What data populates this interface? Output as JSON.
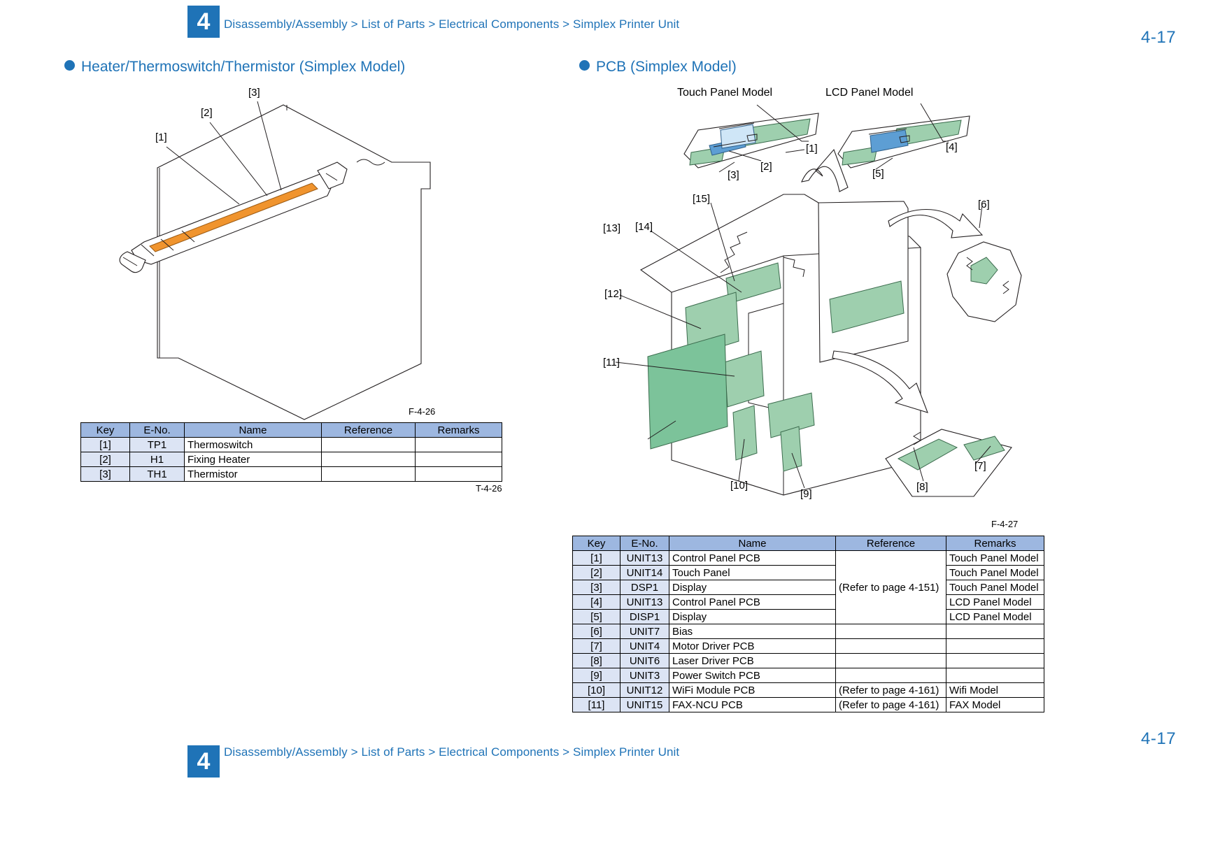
{
  "header": {
    "chapter": "4",
    "breadcrumb": "Disassembly/Assembly > List of Parts > Electrical Components > Simplex Printer Unit",
    "page_number": "4-17"
  },
  "footer": {
    "chapter": "4",
    "breadcrumb": "Disassembly/Assembly > List of Parts > Electrical Components > Simplex Printer Unit",
    "page_number": "4-17"
  },
  "colors": {
    "accent_blue": "#1f73b7",
    "table_header": "#9db7e0",
    "table_key_cell": "#dce4f4",
    "pcb_green": "#9ecfae",
    "display_blue": "#cfe6f7",
    "heater_orange": "#f0942e"
  },
  "sections": {
    "left": {
      "title": "Heater/Thermoswitch/Thermistor (Simplex Model)",
      "figure_caption": "F-4-26",
      "table_caption": "T-4-26",
      "callouts": [
        "[1]",
        "[2]",
        "[3]"
      ],
      "table": {
        "headers": [
          "Key",
          "E-No.",
          "Name",
          "Reference",
          "Remarks"
        ],
        "rows": [
          {
            "key": "[1]",
            "eno": "TP1",
            "name": "Thermoswitch",
            "reference": "",
            "remarks": ""
          },
          {
            "key": "[2]",
            "eno": "H1",
            "name": "Fixing Heater",
            "reference": "",
            "remarks": ""
          },
          {
            "key": "[3]",
            "eno": "TH1",
            "name": "Thermistor",
            "reference": "",
            "remarks": ""
          }
        ]
      }
    },
    "right": {
      "title": "PCB (Simplex Model)",
      "figure_caption": "F-4-27",
      "model_labels": [
        "Touch Panel Model",
        "LCD Panel Model"
      ],
      "callouts": [
        "[1]",
        "[2]",
        "[3]",
        "[4]",
        "[5]",
        "[6]",
        "[7]",
        "[8]",
        "[9]",
        "[10]",
        "[11]",
        "[12]",
        "[13]",
        "[14]",
        "[15]"
      ],
      "table": {
        "headers": [
          "Key",
          "E-No.",
          "Name",
          "Reference",
          "Remarks"
        ],
        "merged_reference_rows_1_to_5": "(Refer to page 4-151)",
        "rows": [
          {
            "key": "[1]",
            "eno": "UNIT13",
            "name": "Control Panel PCB",
            "reference": "(Refer to page 4-151)",
            "remarks": "Touch Panel Model"
          },
          {
            "key": "[2]",
            "eno": "UNIT14",
            "name": "Touch Panel",
            "reference": "",
            "remarks": "Touch Panel Model"
          },
          {
            "key": "[3]",
            "eno": "DSP1",
            "name": "Display",
            "reference": "",
            "remarks": "Touch Panel Model"
          },
          {
            "key": "[4]",
            "eno": "UNIT13",
            "name": "Control Panel PCB",
            "reference": "",
            "remarks": "LCD Panel Model"
          },
          {
            "key": "[5]",
            "eno": "DISP1",
            "name": "Display",
            "reference": "",
            "remarks": "LCD Panel Model"
          },
          {
            "key": "[6]",
            "eno": "UNIT7",
            "name": "Bias",
            "reference": "",
            "remarks": ""
          },
          {
            "key": "[7]",
            "eno": "UNIT4",
            "name": "Motor Driver PCB",
            "reference": "",
            "remarks": ""
          },
          {
            "key": "[8]",
            "eno": "UNIT6",
            "name": "Laser Driver PCB",
            "reference": "",
            "remarks": ""
          },
          {
            "key": "[9]",
            "eno": "UNIT3",
            "name": "Power Switch PCB",
            "reference": "",
            "remarks": ""
          },
          {
            "key": "[10]",
            "eno": "UNIT12",
            "name": "WiFi Module PCB",
            "reference": "(Refer to page 4-161)",
            "remarks": "Wifi Model"
          },
          {
            "key": "[11]",
            "eno": "UNIT15",
            "name": "FAX-NCU PCB",
            "reference": "(Refer to page 4-161)",
            "remarks": "FAX Model"
          }
        ]
      }
    }
  }
}
